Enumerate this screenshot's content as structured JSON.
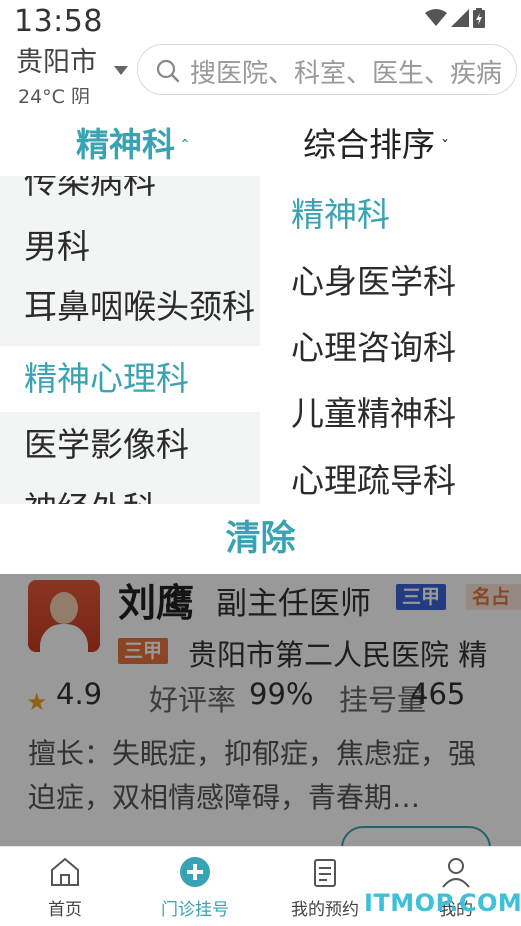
{
  "status_bar": {
    "time": "13:58"
  },
  "header": {
    "city": "贵阳市",
    "weather": "24°C 阴",
    "search_placeholder": "搜医院、科室、医生、疾病"
  },
  "filter": {
    "department_tab": "精神科",
    "sort_tab": "综合排序"
  },
  "dropdown": {
    "departments": [
      "传染病科",
      "男科",
      "耳鼻咽喉头颈科",
      "精神心理科",
      "医学影像科",
      "神经外科"
    ],
    "active_department": "精神心理科",
    "sub_departments": [
      "精神科",
      "心身医学科",
      "心理咨询科",
      "儿童精神科",
      "心理疏导科"
    ],
    "active_sub_department": "精神科",
    "clear_label": "清除"
  },
  "doctor_card": {
    "name": "刘鹰",
    "title": "副主任医师",
    "grade_badge": "三甲",
    "more_badge": "名占",
    "hospital_badge": "三甲",
    "hospital": "贵阳市第二人民医院 精",
    "rating": "4.9",
    "good_rate_label": "好评率",
    "good_rate_value": "99%",
    "registration_label": "挂号量",
    "registration_value": "465",
    "specialty": "擅长：失眠症，抑郁症，焦虑症，强迫症，双相情感障碍，青春期…"
  },
  "bottom_nav": {
    "items": [
      {
        "label": "首页",
        "icon": "home-icon"
      },
      {
        "label": "门诊挂号",
        "icon": "plus-circle-icon"
      },
      {
        "label": "我的预约",
        "icon": "clipboard-icon"
      },
      {
        "label": "我的",
        "icon": "user-icon"
      }
    ],
    "active_index": 1
  },
  "watermark": "ITMOP.COM",
  "colors": {
    "accent": "#3aa3b3",
    "overlay": "rgba(0,0,0,0.4)"
  }
}
